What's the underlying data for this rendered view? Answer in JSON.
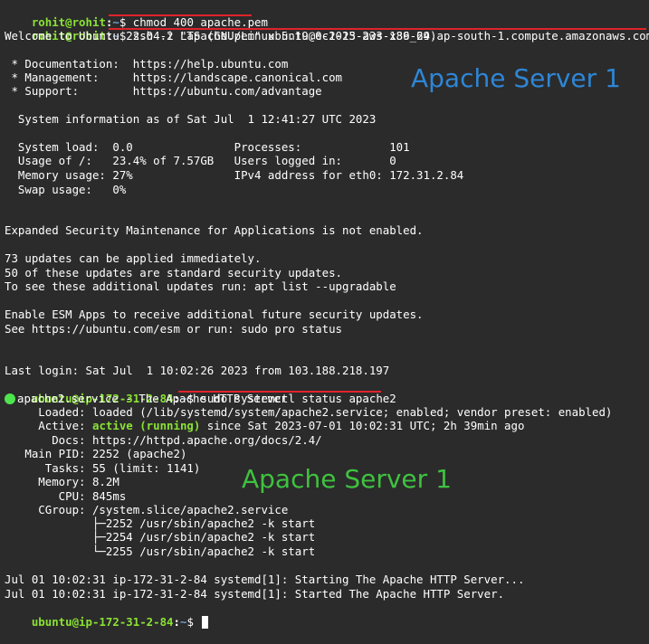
{
  "terminal": {
    "prompt1": {
      "user": "rohit@rohit",
      "sep": ":",
      "path": "~",
      "dollar": "$ ",
      "command": "chmod 400 apache.pem"
    },
    "prompt2": {
      "user": "rohit@rohit",
      "sep": ":",
      "path": "~",
      "dollar": "$ ",
      "command": "ssh -i \"apache.pem\" ubuntu@ec2-13-233-139-29.ap-south-1.compute.amazonaws.com"
    },
    "welcome": "Welcome to Ubuntu 22.04.2 LTS (GNU/Linux 5.19.0-1025-aws x86_64)",
    "doc": " * Documentation:  https://help.ubuntu.com",
    "mgmt": " * Management:     https://landscape.canonical.com",
    "support": " * Support:        https://ubuntu.com/advantage",
    "sysinfo": "  System information as of Sat Jul  1 12:41:27 UTC 2023",
    "stats": [
      "  System load:  0.0               Processes:             101",
      "  Usage of /:   23.4% of 7.57GB   Users logged in:       0",
      "  Memory usage: 27%               IPv4 address for eth0: 172.31.2.84",
      "  Swap usage:   0%"
    ],
    "esm": "Expanded Security Maintenance for Applications is not enabled.",
    "updates": [
      "73 updates can be applied immediately.",
      "50 of these updates are standard security updates.",
      "To see these additional updates run: apt list --upgradable"
    ],
    "esm_apps": [
      "Enable ESM Apps to receive additional future security updates.",
      "See https://ubuntu.com/esm or run: sudo pro status"
    ],
    "last_login": "Last login: Sat Jul  1 10:02:26 2023 from 103.188.218.197",
    "prompt3": {
      "user": "ubuntu@ip-172-31-2-84",
      "sep": ":",
      "path": "~",
      "dollar": "$ ",
      "command": "sudo systemctl status apache2"
    },
    "service": {
      "title": "apache2.service - The Apache HTTP Server",
      "loaded": "     Loaded: loaded (/lib/systemd/system/apache2.service; enabled; vendor preset: enabled)",
      "active_label": "     Active: ",
      "active_state": "active (running)",
      "active_rest": " since Sat 2023-07-01 10:02:31 UTC; 2h 39min ago",
      "docs": "       Docs: https://httpd.apache.org/docs/2.4/",
      "main_pid": "   Main PID: 2252 (apache2)",
      "tasks": "      Tasks: 55 (limit: 1141)",
      "memory": "     Memory: 8.2M",
      "cpu": "        CPU: 845ms",
      "cgroup": "     CGroup: /system.slice/apache2.service",
      "proc1": "             ├─2252 /usr/sbin/apache2 -k start",
      "proc2": "             ├─2254 /usr/sbin/apache2 -k start",
      "proc3": "             └─2255 /usr/sbin/apache2 -k start"
    },
    "log1": "Jul 01 10:02:31 ip-172-31-2-84 systemd[1]: Starting The Apache HTTP Server...",
    "log2": "Jul 01 10:02:31 ip-172-31-2-84 systemd[1]: Started The Apache HTTP Server.",
    "prompt4": {
      "user": "ubuntu@ip-172-31-2-84",
      "sep": ":",
      "path": "~",
      "dollar": "$ "
    }
  },
  "annotations": {
    "label_top": "Apache Server 1",
    "label_bottom": "Apache Server 1",
    "top_color": "#2e86d6",
    "bottom_color": "#3fc23f",
    "underline_color": "#e0242a"
  }
}
